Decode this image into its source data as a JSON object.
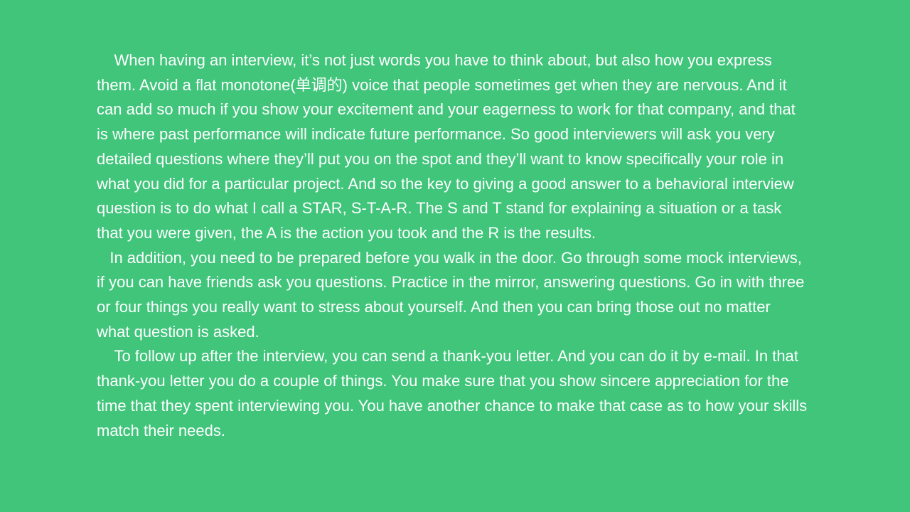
{
  "slide": {
    "background_color": "#40c57b",
    "text_color": "#ffffff",
    "paragraphs": [
      "    When having an interview, it’s not just words you have to think about, but also how you express them. Avoid a flat monotone(单调的) voice that people sometimes get when they are nervous. And it can add so much if you show your excitement and your eagerness to work for that company, and that is where past performance will indicate future performance. So good interviewers will ask you very detailed questions where they’ll put you on the spot and they’ll want to know specifically your role in what you did for a particular project. And so the key to giving a good answer to a behavioral interview question is to do what I call a STAR, S-T-A-R. The S and T stand for explaining a situation or a task that you were given, the A is the action you took and the R is the results.",
      "   In addition, you need to be prepared before you walk in the door. Go through some mock interviews, if you can have friends ask you questions. Practice in the mirror, answering questions. Go in with three or four things you really want to stress about yourself. And then you can bring those out no matter what question is asked.",
      "    To follow up after the interview, you can send a thank-you letter. And you can do it by e-mail. In that thank-you letter you do a couple of things. You make sure that you show sincere appreciation for the time that they spent interviewing you. You have another chance to make that case as to how your skills match their needs."
    ]
  }
}
